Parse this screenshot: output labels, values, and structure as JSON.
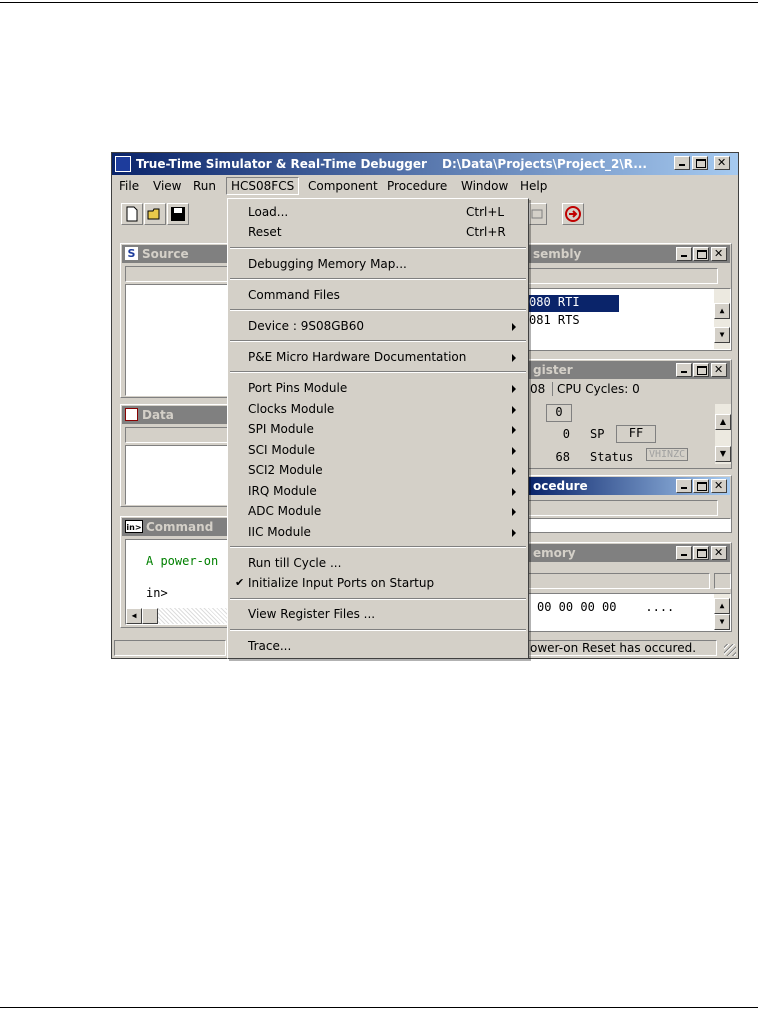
{
  "window": {
    "title": "True-Time Simulator & Real-Time Debugger",
    "path": "D:\\Data\\Projects\\Project_2\\R..."
  },
  "menubar": [
    "File",
    "View",
    "Run",
    "HCS08FCS",
    "Component",
    "Procedure",
    "Window",
    "Help"
  ],
  "panels": {
    "source": {
      "title": "Source"
    },
    "data": {
      "title": "Data"
    },
    "command": {
      "title": "Command",
      "line1": "A power-on",
      "line2": "in>"
    },
    "assembly": {
      "title": "sembly",
      "row1": "080 RTI",
      "row2": "081 RTS"
    },
    "register": {
      "title": "gister",
      "cpu_prefix": "08",
      "cpu_cycles": "CPU Cycles: 0",
      "r1_val": "0",
      "r2_val": "0",
      "sp_label": "SP",
      "sp_val": "FF",
      "r3_val": "68",
      "status_label": "Status",
      "status_val": "VHINZC"
    },
    "procedure": {
      "title": "ocedure"
    },
    "memory": {
      "title": "emory",
      "row": "00 00 00 00    ...."
    }
  },
  "statusbar": {
    "message": "ower-on Reset has occured."
  },
  "dropdown": {
    "items": [
      {
        "label": "Load...",
        "shortcut": "Ctrl+L"
      },
      {
        "label": "Reset",
        "shortcut": "Ctrl+R"
      },
      {
        "label": "Debugging Memory Map..."
      },
      {
        "label": "Command Files"
      },
      {
        "label": "Device : 9S08GB60"
      },
      {
        "label": "P&E Micro Hardware Documentation"
      },
      {
        "label": "Port Pins Module"
      },
      {
        "label": "Clocks Module"
      },
      {
        "label": "SPI Module"
      },
      {
        "label": "SCI Module"
      },
      {
        "label": "SCI2 Module"
      },
      {
        "label": "IRQ Module"
      },
      {
        "label": "ADC Module"
      },
      {
        "label": "IIC Module"
      },
      {
        "label": "Run till Cycle ..."
      },
      {
        "label": "Initialize Input Ports on Startup",
        "checked": true
      },
      {
        "label": "View Register Files ..."
      },
      {
        "label": "Trace..."
      }
    ]
  }
}
